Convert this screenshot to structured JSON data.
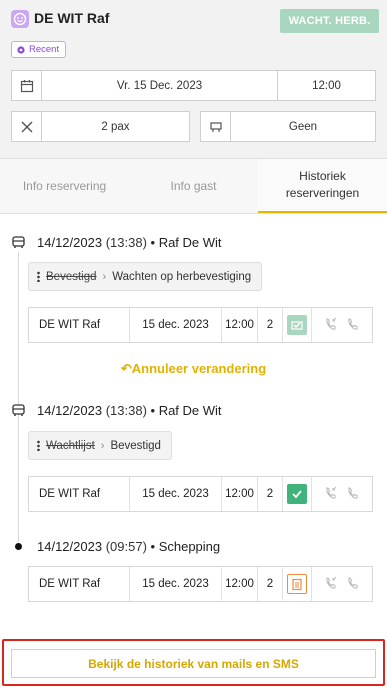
{
  "header": {
    "guest_name": "DE WIT Raf",
    "status_button": "WACHT. HERB.",
    "recent_tag": "Recent"
  },
  "reservation": {
    "date": "Vr. 15 Dec. 2023",
    "time": "12:00",
    "pax": "2 pax",
    "table": "Geen"
  },
  "tabs": [
    {
      "label": "Info reservering",
      "active": false
    },
    {
      "label": "Info gast",
      "active": false
    },
    {
      "label": "Historiek reserveringen",
      "active": true
    }
  ],
  "history": [
    {
      "date": "14/12/2023",
      "time": "(13:38)",
      "actor": "Raf De Wit",
      "change_from": "Bevestigd",
      "change_to": "Wachten op herbevestiging",
      "row": {
        "name": "DE WIT Raf",
        "date": "15 dec. 2023",
        "time": "12:00",
        "pax": "2",
        "status_icon": "awaiting-confirmation-icon"
      }
    },
    {
      "date": "14/12/2023",
      "time": "(13:38)",
      "actor": "Raf De Wit",
      "change_from": "Wachtlijst",
      "change_to": "Bevestigd",
      "row": {
        "name": "DE WIT Raf",
        "date": "15 dec. 2023",
        "time": "12:00",
        "pax": "2",
        "status_icon": "confirmed-icon"
      }
    },
    {
      "date": "14/12/2023",
      "time": "(09:57)",
      "actor": "Schepping",
      "row": {
        "name": "DE WIT Raf",
        "date": "15 dec. 2023",
        "time": "12:00",
        "pax": "2",
        "status_icon": "waitlist-icon"
      }
    }
  ],
  "undo_label": "Annuleer verandering",
  "bottom_button": "Bekijk de historiek van mails en SMS",
  "colors": {
    "accent": "#e0b300",
    "confirmed": "#3fb37a",
    "awaiting": "#a9d6bf",
    "waitlist": "#f08a3c",
    "recent": "#8b4ad8",
    "highlight_border": "#d9261c"
  }
}
